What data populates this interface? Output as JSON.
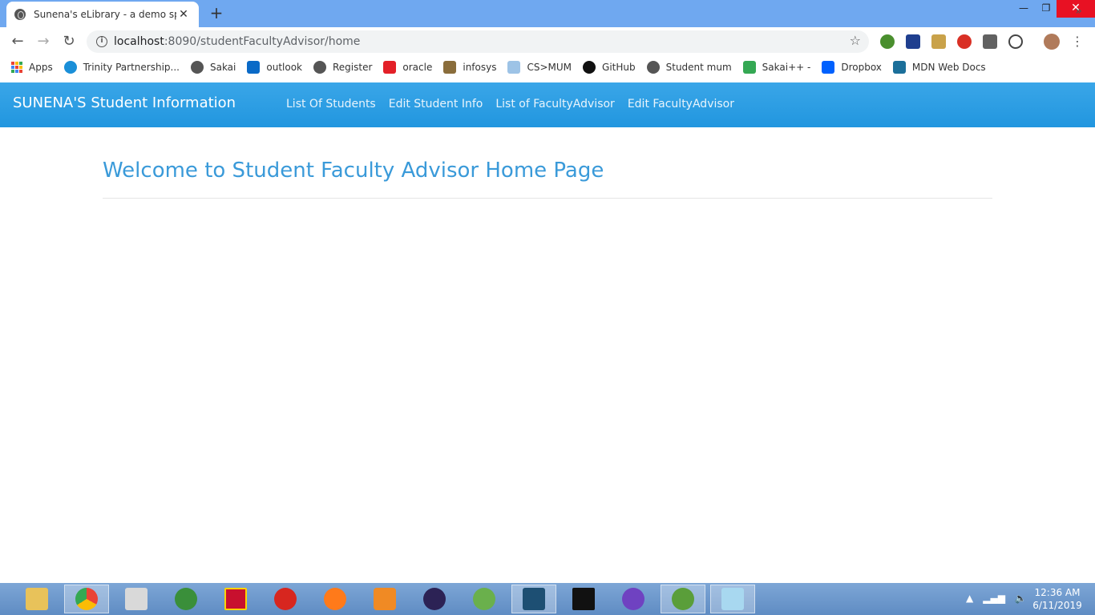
{
  "browser": {
    "tab_title": "Sunena's eLibrary - a demo spring",
    "url_host": "localhost",
    "url_path": ":8090/studentFacultyAdvisor/home",
    "bookmarks": [
      {
        "label": "Apps",
        "icon": "apps-grid-icon",
        "color": "#e94235"
      },
      {
        "label": "Trinity Partnership...",
        "icon": "edge-icon",
        "color": "#1a8fd8"
      },
      {
        "label": "Sakai",
        "icon": "globe-icon",
        "color": "#555555"
      },
      {
        "label": "outlook",
        "icon": "outlook-icon",
        "color": "#0a6ac7"
      },
      {
        "label": "Register",
        "icon": "globe-icon",
        "color": "#555555"
      },
      {
        "label": "oracle",
        "icon": "oracle-icon",
        "color": "#e32028"
      },
      {
        "label": "infosys",
        "icon": "image-icon",
        "color": "#8a6d3b"
      },
      {
        "label": "CS>MUM",
        "icon": "page-icon",
        "color": "#9dc3e6"
      },
      {
        "label": "GitHub",
        "icon": "github-icon",
        "color": "#111111"
      },
      {
        "label": "Student mum",
        "icon": "globe-icon",
        "color": "#555555"
      },
      {
        "label": "Sakai++ -",
        "icon": "drive-icon",
        "color": "#34a853"
      },
      {
        "label": "Dropbox",
        "icon": "dropbox-icon",
        "color": "#0061fe"
      },
      {
        "label": "MDN Web Docs",
        "icon": "mdn-icon",
        "color": "#1b6f9a"
      }
    ],
    "more_bookmarks": "»"
  },
  "app": {
    "brand": "SUNENA'S Student Information",
    "nav": [
      "List Of Students",
      "Edit Student Info",
      "List of FacultyAdvisor",
      "Edit FacultyAdvisor"
    ],
    "heading": "Welcome to Student Faculty Advisor Home Page"
  },
  "taskbar": {
    "clock_time": "12:36 AM",
    "clock_date": "6/11/2019"
  }
}
